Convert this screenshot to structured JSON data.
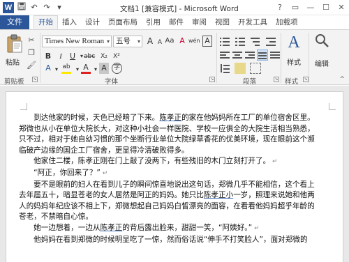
{
  "window": {
    "title": "文档1 [兼容模式] - Microsoft Word",
    "help": "?",
    "restore": "▭",
    "minimize": "—",
    "maximize": "☐",
    "close": "✕"
  },
  "qat": {
    "logo": "W",
    "save": "💾",
    "undo": "↶",
    "redo": "↷",
    "more": "▾"
  },
  "tabs": {
    "file": "文件",
    "items": [
      "开始",
      "插入",
      "设计",
      "页面布局",
      "引用",
      "邮件",
      "审阅",
      "视图",
      "开发工具",
      "加载项"
    ]
  },
  "ribbon": {
    "clipboard": {
      "paste_label": "粘贴",
      "group": "剪贴板"
    },
    "font": {
      "name": "Times New Roman",
      "size": "五号",
      "group": "字体",
      "bold": "B",
      "italic": "I",
      "underline": "U",
      "strike": "abc",
      "subscript": "X₂",
      "superscript": "X²",
      "grow": "A",
      "shrink": "A",
      "aa": "Aa",
      "clear": "A",
      "phonetic": "wén",
      "border": "A",
      "highlight": "ab",
      "fontcolor": "A",
      "shade": "A",
      "enclose": "字"
    },
    "paragraph": {
      "group": "段落"
    },
    "styles": {
      "label": "样式",
      "glyph": "A",
      "group": "样式"
    },
    "editing": {
      "label": "编辑",
      "glyph": "🔍"
    },
    "collapse": "^"
  },
  "document": {
    "lines": [
      {
        "pre": "　　到达他家的时候，天色已经暗了下来。",
        "u": "陈孝正",
        "post": "的家在他妈妈所在工厂的单位宿舍区里。",
        "mark": ""
      },
      {
        "pre": "郑微也从小在单位大院长大，对这种小社会一样医院、学校一应俱全的大院生活相当熟悉，",
        "u": "",
        "post": "",
        "mark": ""
      },
      {
        "pre": "只不过，相对于她自幼习惯的那个坐断行业单位大院绿草香花的优美环境，现在眼前这个濒",
        "u": "",
        "post": "",
        "mark": ""
      },
      {
        "pre": "临破产边缘的国企工厂宿舍，更显得冷清破败得多。",
        "u": "",
        "post": "",
        "mark": ""
      },
      {
        "pre": "　　他家住二楼，陈孝正刚在门上敲了没两下，有些残旧的木门立刻打开了。",
        "u": "",
        "post": "",
        "mark": "↵"
      },
      {
        "pre": "　　“阿正，你回来了？”",
        "u": "",
        "post": "",
        "mark": "↵"
      },
      {
        "pre": "　　要不是眼前的妇人在看到儿子的瞬间惊喜地说出这句话，郑微几乎不能相信，这个看上",
        "u": "",
        "post": "",
        "mark": ""
      },
      {
        "pre": "去年届五十，暗显苍老的女人居然是阿正的妈妈。她只比",
        "u": "陈孝正小",
        "post": "一岁，照理来说她和他两",
        "mark": ""
      },
      {
        "pre": "人的妈妈年纪应该不相上下，郑微想起自己妈妈白皙漂亮的面容，在看看他妈妈超乎年龄的",
        "u": "",
        "post": "",
        "mark": ""
      },
      {
        "pre": "苍老，不禁暗自心惊。",
        "u": "",
        "post": "",
        "mark": ""
      },
      {
        "pre": "　　她一边想着，一边从",
        "u": "陈孝正",
        "post": "的背后露出脸来，甜甜一笑，“阿姨好。”",
        "mark": "↵"
      },
      {
        "pre": "　　他妈妈在看到郑微的时候明显吃了一惊，然而俗话说“伸手不打笑脸人”，面对郑微的",
        "u": "",
        "post": "",
        "mark": ""
      }
    ]
  }
}
